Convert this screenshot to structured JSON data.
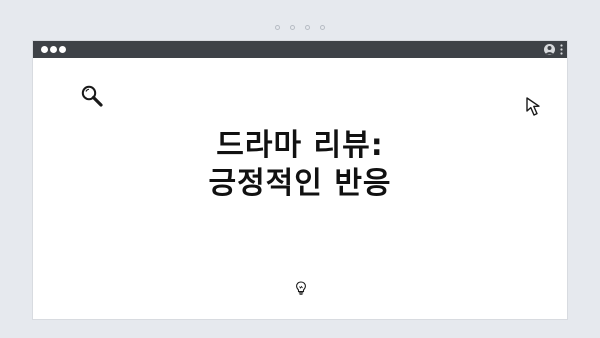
{
  "window": {
    "title_lines": [
      "드라마 리뷰:",
      "긍정적인 반응"
    ]
  },
  "icons": {
    "search": "search-icon",
    "cursor": "cursor-arrow-icon",
    "bulb": "lightbulb-icon",
    "profile": "profile-icon",
    "menu": "kebab-menu-icon"
  },
  "colors": {
    "background": "#e6e9ee",
    "titlebar": "#3e4247",
    "content": "#ffffff",
    "text": "#111111"
  }
}
